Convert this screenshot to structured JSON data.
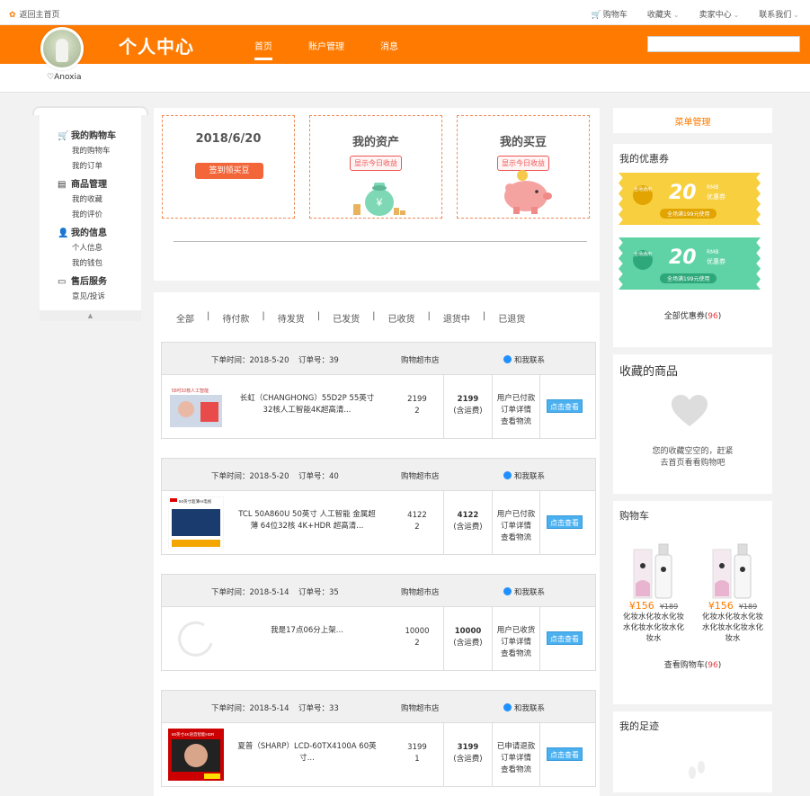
{
  "topbar": {
    "home": "返回主首页",
    "links": [
      {
        "label": "购物车",
        "caret": false
      },
      {
        "label": "收藏夹",
        "caret": true
      },
      {
        "label": "卖家中心",
        "caret": true
      },
      {
        "label": "联系我们",
        "caret": true
      }
    ]
  },
  "header": {
    "title": "个人中心",
    "nav": [
      "首页",
      "账户管理",
      "消息"
    ],
    "active_nav": "首页",
    "search_value": "",
    "username": "♡Anoxia"
  },
  "sidebar": {
    "groups": [
      {
        "label": "我的购物车",
        "icon": "cart-icon",
        "items": [
          "我的购物车",
          "我的订单"
        ]
      },
      {
        "label": "商品管理",
        "icon": "document-icon",
        "items": [
          "我的收藏",
          "我的评价"
        ]
      },
      {
        "label": "我的信息",
        "icon": "person-icon",
        "items": [
          "个人信息",
          "我的钱包"
        ]
      },
      {
        "label": "售后服务",
        "icon": "service-icon",
        "items": [
          "意见/投诉"
        ]
      }
    ]
  },
  "cards": {
    "date": "2018/6/20",
    "checkin_button": "签到领买豆",
    "assets_title": "我的资产",
    "assets_tag": "显示今日收益",
    "beans_title": "我的买豆",
    "beans_tag": "显示今日收益"
  },
  "order_tabs": [
    "全部",
    "待付款",
    "待发货",
    "已发货",
    "已收货",
    "退货中",
    "已退货"
  ],
  "orders": [
    {
      "time": "下单时间：2018-5-20",
      "order_no": "订单号：39",
      "shop": "购物超市店",
      "contact": "和我联系",
      "thumb_text": "55吋32核人工智能",
      "name": "长虹（CHANGHONG）55D2P 55英寸32核人工智能4K超高清...",
      "unit_price": "2199",
      "qty": "2",
      "total": "2199",
      "total_note": "(含运费)",
      "status": [
        "用户已付款",
        "订单详情",
        "查看物流"
      ],
      "view": "点击查看"
    },
    {
      "time": "下单时间：2018-5-20",
      "order_no": "订单号：40",
      "shop": "购物超市店",
      "contact": "和我联系",
      "thumb_text": "50英寸超薄AI电视",
      "name": "TCL 50A860U 50英寸 人工智能 金属超薄 64位32核 4K+HDR 超高清...",
      "unit_price": "4122",
      "qty": "2",
      "total": "4122",
      "total_note": "(含运费)",
      "status": [
        "用户已付款",
        "订单详情",
        "查看物流"
      ],
      "view": "点击查看"
    },
    {
      "time": "下单时间：2018-5-14",
      "order_no": "订单号：35",
      "shop": "购物超市店",
      "contact": "和我联系",
      "thumb_text": "",
      "name": "我是17点06分上架...",
      "unit_price": "10000",
      "qty": "2",
      "total": "10000",
      "total_note": "(含运费)",
      "status": [
        "用户已收货",
        "订单详情",
        "查看物流"
      ],
      "view": "点击查看"
    },
    {
      "time": "下单时间：2018-5-14",
      "order_no": "订单号：33",
      "shop": "购物超市店",
      "contact": "和我联系",
      "thumb_text": "60英寸4K语音智能HDR",
      "name": "夏普（SHARP）LCD-60TX4100A 60英寸...",
      "unit_price": "3199",
      "qty": "1",
      "total": "3199",
      "total_note": "(含运费)",
      "status": [
        "已申请退款",
        "订单详情",
        "查看物流"
      ],
      "view": "点击查看"
    }
  ],
  "right": {
    "menu_manage": "菜单管理",
    "coupons_title": "我的优惠券",
    "coupons": [
      {
        "badge": "全场通用",
        "amount": "20",
        "rmb": "RMB",
        "type": "优惠券",
        "condition": "全场满199元使用",
        "color": "#f7cf3f",
        "dark": "#e1a400"
      },
      {
        "badge": "全场通用",
        "amount": "20",
        "rmb": "RMB",
        "type": "优惠券",
        "condition": "全场满199元使用",
        "color": "#5fd3a5",
        "dark": "#2ea87a"
      }
    ],
    "all_coupons": "全部优惠券",
    "coupons_count": "96",
    "fav_title": "收藏的商品",
    "fav_empty_line1": "您的收藏空空的，赶紧",
    "fav_empty_line2": "去首页看看购物吧",
    "cart_title": "购物车",
    "cart_items": [
      {
        "price": "¥156",
        "old": "¥189",
        "name": "化妆水化妆水化妆水化妆水化妆水化妆水"
      },
      {
        "price": "¥156",
        "old": "¥189",
        "name": "化妆水化妆水化妆水化妆水化妆水化妆水"
      }
    ],
    "view_cart": "查看购物车",
    "cart_count": "96",
    "footprint_title": "我的足迹"
  }
}
